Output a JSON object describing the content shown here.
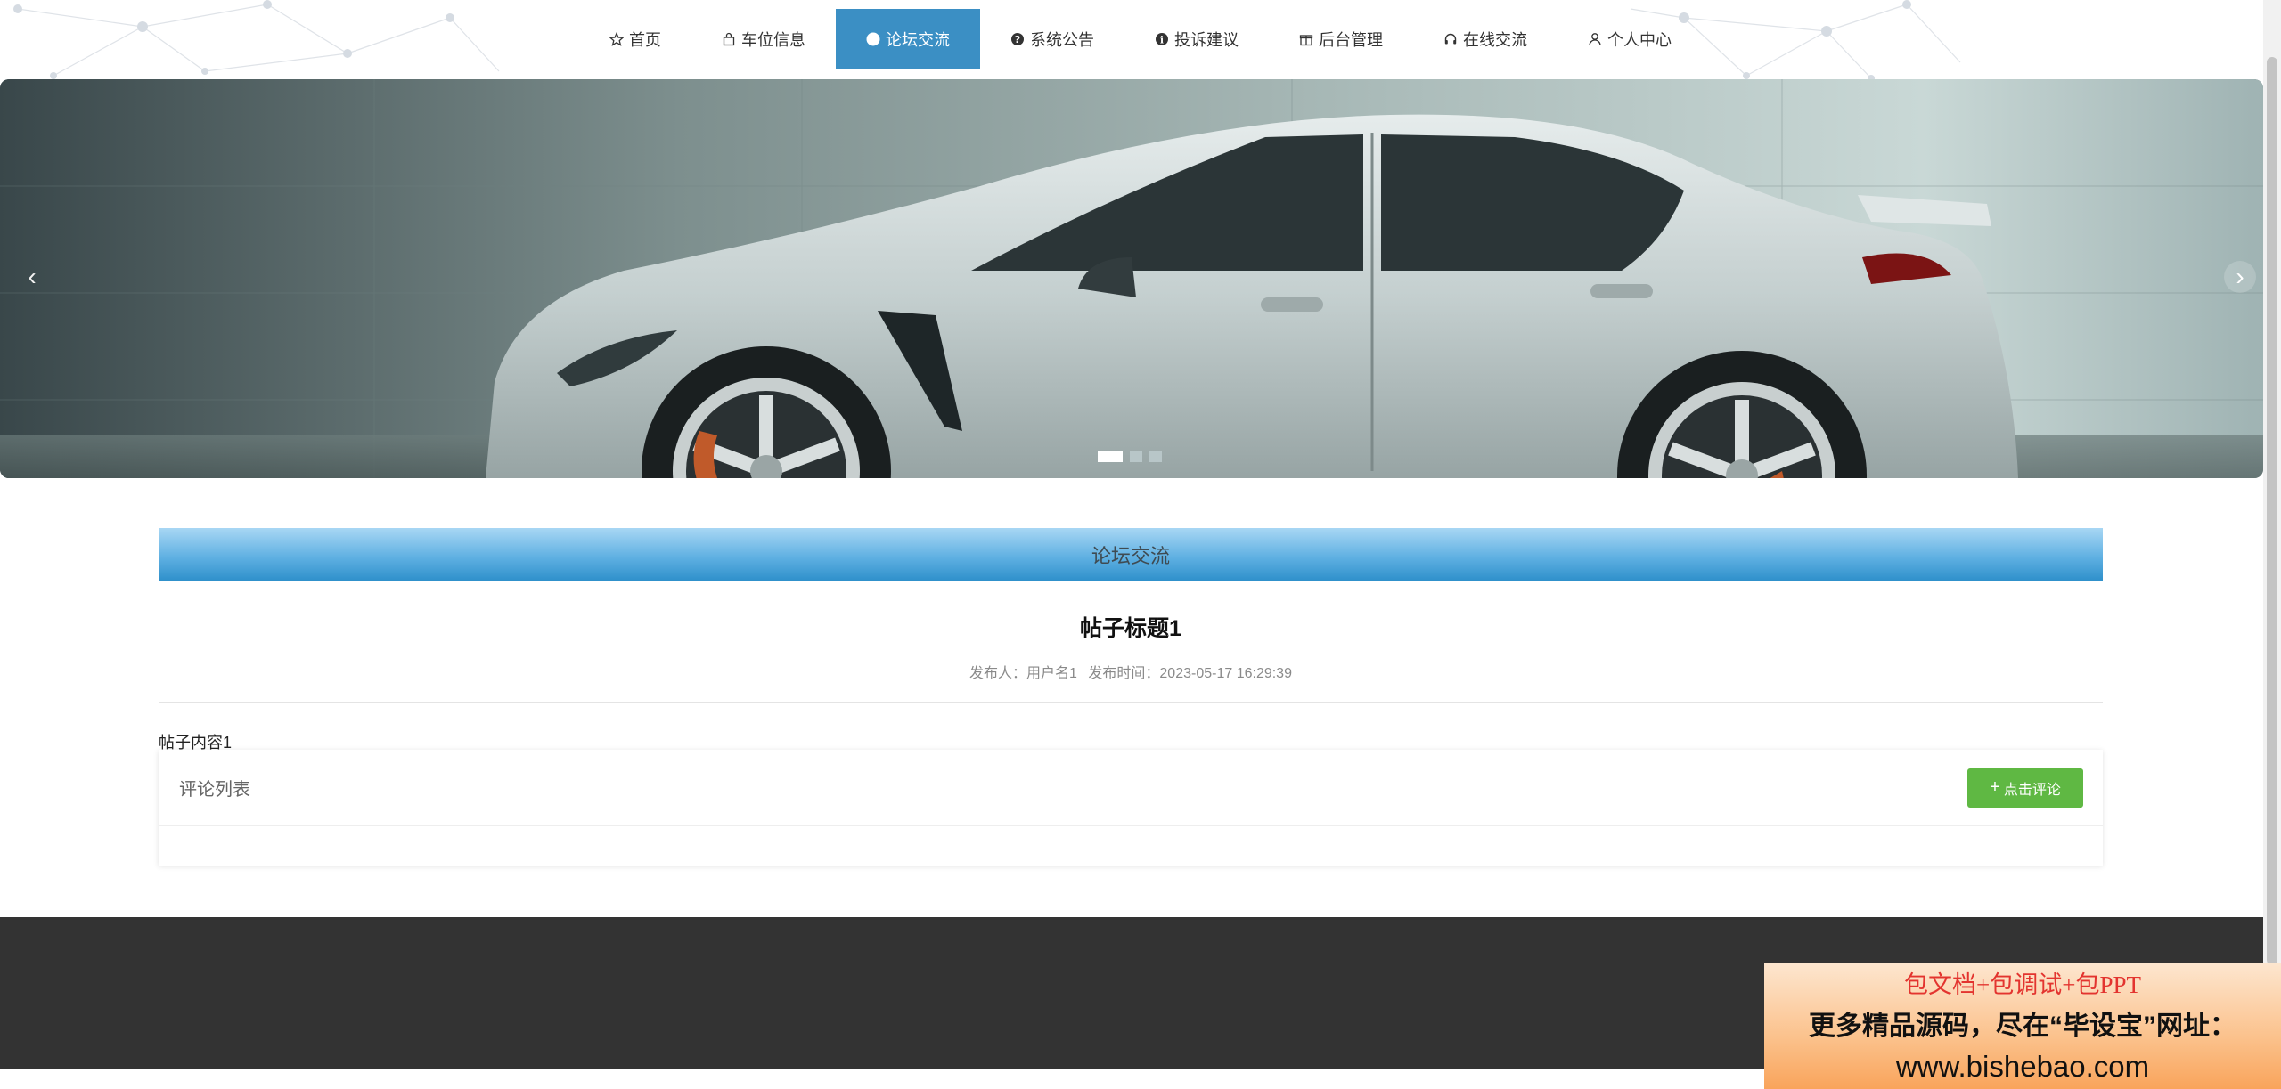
{
  "nav": {
    "items": [
      {
        "label": "首页",
        "icon": "star-icon"
      },
      {
        "label": "车位信息",
        "icon": "bag-icon"
      },
      {
        "label": "论坛交流",
        "icon": "info-circle-icon"
      },
      {
        "label": "系统公告",
        "icon": "question-circle-icon"
      },
      {
        "label": "投诉建议",
        "icon": "info-circle-icon"
      },
      {
        "label": "后台管理",
        "icon": "gift-icon"
      },
      {
        "label": "在线交流",
        "icon": "headset-icon"
      },
      {
        "label": "个人中心",
        "icon": "user-icon"
      }
    ],
    "active_index": 2,
    "active_color": "#3b8fc4"
  },
  "banner": {
    "prev_glyph": "‹",
    "next_glyph": "›",
    "slide_count": 3,
    "active_slide": 1
  },
  "section": {
    "title": "论坛交流",
    "header_color": "#3c96d0"
  },
  "post": {
    "title": "帖子标题1",
    "author_label": "发布人：",
    "author": "用户名1",
    "time_label": "发布时间：",
    "time": "2023-05-17 16:29:39",
    "content": "帖子内容1"
  },
  "comments": {
    "title": "评论列表",
    "button_label": "点击评论",
    "button_color": "#5fb843"
  },
  "footer": {
    "color": "#333333"
  },
  "watermark": {
    "line1": "包文档+包调试+包PPT",
    "line2": "更多精品源码，尽在“毕设宝”网址：",
    "line3": "www.bishebao.com"
  }
}
